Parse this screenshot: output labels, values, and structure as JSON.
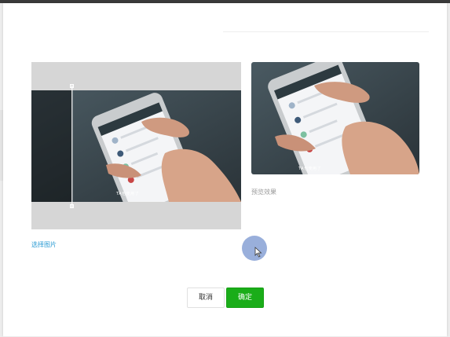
{
  "dialog": {
    "crop_panel": {
      "image_caption": "TA也使用了"
    },
    "preview": {
      "label": "预览效果",
      "image_caption": "TA也使用了"
    },
    "select_link": "选择图片",
    "buttons": {
      "cancel": "取消",
      "confirm": "确定"
    }
  },
  "colors": {
    "confirm": "#1aad19",
    "link": "#2a9bd3",
    "photo_bg": "#3a4950"
  },
  "icons": {
    "cursor": "mouse-pointer-icon"
  }
}
